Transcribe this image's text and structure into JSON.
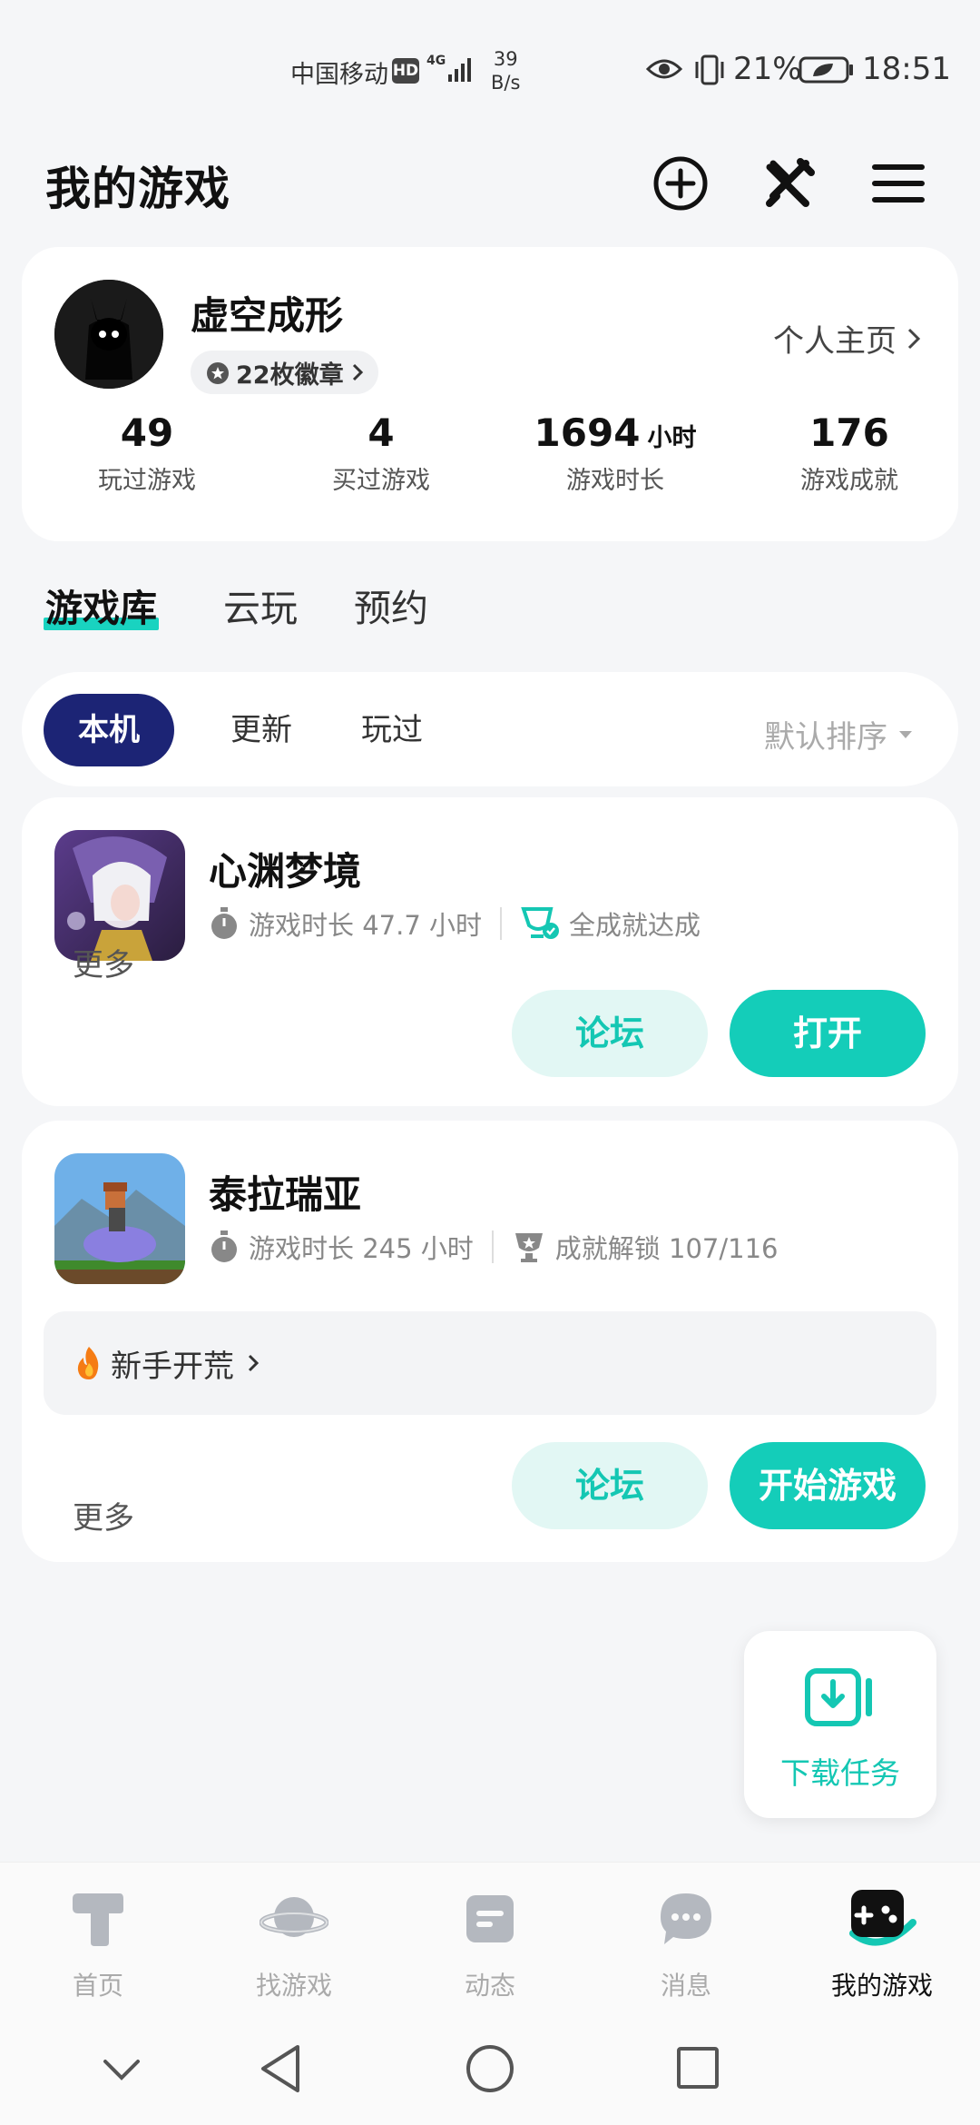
{
  "status_bar": {
    "carrier": "中国移动",
    "hd": "HD",
    "network": "4G",
    "speed_value": "39",
    "speed_unit": "B/s",
    "battery": "21%",
    "time": "18:51"
  },
  "header": {
    "title": "我的游戏",
    "icons": [
      "add-circle-icon",
      "tools-icon",
      "menu-icon"
    ]
  },
  "profile": {
    "username": "虚空成形",
    "badges": "22枚徽章",
    "homepage_link": "个人主页",
    "stats": [
      {
        "value": "49",
        "unit": "",
        "label": "玩过游戏"
      },
      {
        "value": "4",
        "unit": "",
        "label": "买过游戏"
      },
      {
        "value": "1694",
        "unit": "小时",
        "label": "游戏时长"
      },
      {
        "value": "176",
        "unit": "",
        "label": "游戏成就"
      }
    ]
  },
  "main_tabs": [
    {
      "label": "游戏库",
      "active": true
    },
    {
      "label": "云玩",
      "active": false
    },
    {
      "label": "预约",
      "active": false
    }
  ],
  "filters": {
    "chips": [
      {
        "label": "本机",
        "active": true
      },
      {
        "label": "更新",
        "active": false
      },
      {
        "label": "玩过",
        "active": false
      }
    ],
    "sort": "默认排序"
  },
  "games": [
    {
      "name": "心渊梦境",
      "playtime": "游戏时长 47.7 小时",
      "achievement": "全成就达成",
      "more": "更多",
      "forum": "论坛",
      "action": "打开"
    },
    {
      "name": "泰拉瑞亚",
      "playtime": "游戏时长 245 小时",
      "achievement": "成就解锁 107/116",
      "tip": "新手开荒",
      "more": "更多",
      "forum": "论坛",
      "action": "开始游戏"
    }
  ],
  "download_fab": {
    "label": "下载任务"
  },
  "bottom_nav": [
    {
      "label": "首页",
      "icon": "home-icon",
      "active": false
    },
    {
      "label": "找游戏",
      "icon": "planet-icon",
      "active": false
    },
    {
      "label": "动态",
      "icon": "feed-icon",
      "active": false
    },
    {
      "label": "消息",
      "icon": "message-icon",
      "active": false
    },
    {
      "label": "我的游戏",
      "icon": "gamepad-icon",
      "active": true
    }
  ],
  "colors": {
    "accent": "#14cdb9",
    "active_chip": "#1c2475",
    "background": "#f5f6f8"
  }
}
